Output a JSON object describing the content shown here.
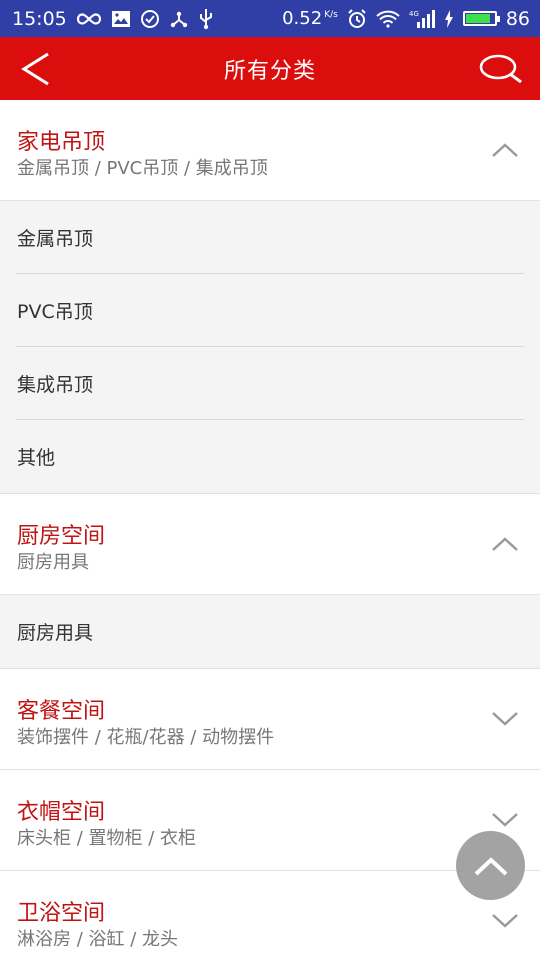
{
  "status_bar": {
    "time": "15:05",
    "speed": "0.52",
    "speed_unit": "K/s",
    "network": "4G",
    "battery": "86",
    "icons": [
      "infinity-icon",
      "image-icon",
      "check-circle-icon",
      "share-icon",
      "usb-icon",
      "alarm-icon",
      "wifi-icon",
      "signal-icon",
      "charging-icon",
      "battery-icon"
    ]
  },
  "header": {
    "title": "所有分类",
    "bg_color": "#dc0d0d"
  },
  "categories": [
    {
      "title": "家电吊顶",
      "subtitle": "金属吊顶 / PVC吊顶 / 集成吊顶",
      "expanded": true,
      "items": [
        "金属吊顶",
        "PVC吊顶",
        "集成吊顶",
        "其他"
      ]
    },
    {
      "title": "厨房空间",
      "subtitle": "厨房用具",
      "expanded": true,
      "items": [
        "厨房用具"
      ]
    },
    {
      "title": "客餐空间",
      "subtitle": "装饰摆件 / 花瓶/花器 / 动物摆件",
      "expanded": false
    },
    {
      "title": "衣帽空间",
      "subtitle": "床头柜 / 置物柜 / 衣柜",
      "expanded": false
    },
    {
      "title": "卫浴空间",
      "subtitle": "淋浴房 / 浴缸 / 龙头",
      "expanded": false
    }
  ]
}
